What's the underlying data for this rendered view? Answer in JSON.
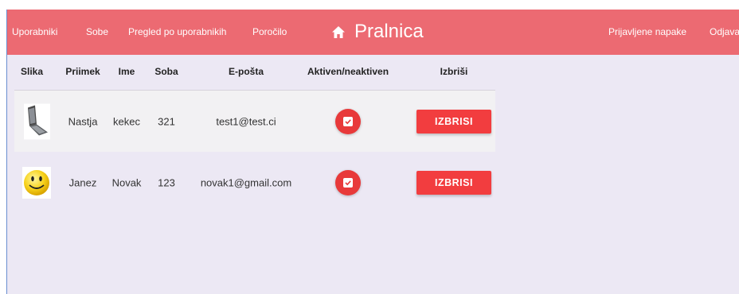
{
  "nav": {
    "left_links": [
      "Uporabniki",
      "Sobe",
      "Pregled po uporabnikih",
      "Poročilo"
    ],
    "brand_icon": "home-icon",
    "brand_title": "Pralnica",
    "right_links": [
      "Prijavljene napake",
      "Odjava"
    ]
  },
  "colors": {
    "navbar": "#ec6a72",
    "background": "#ece8f4",
    "accent": "#f23d3f"
  },
  "table": {
    "headers": [
      "Slika",
      "Priimek",
      "Ime",
      "Soba",
      "E-pošta",
      "Aktiven/neaktiven",
      "Izbriši"
    ],
    "rows": [
      {
        "image": "laptop-icon",
        "priimek": "Nastja",
        "ime": "kekec",
        "soba": "321",
        "eposta": "test1@test.ci",
        "aktiven": true,
        "delete_label": "IZBRISI"
      },
      {
        "image": "smiley-icon",
        "priimek": "Janez",
        "ime": "Novak",
        "soba": "123",
        "eposta": "novak1@gmail.com",
        "aktiven": true,
        "delete_label": "IZBRISI"
      }
    ]
  }
}
